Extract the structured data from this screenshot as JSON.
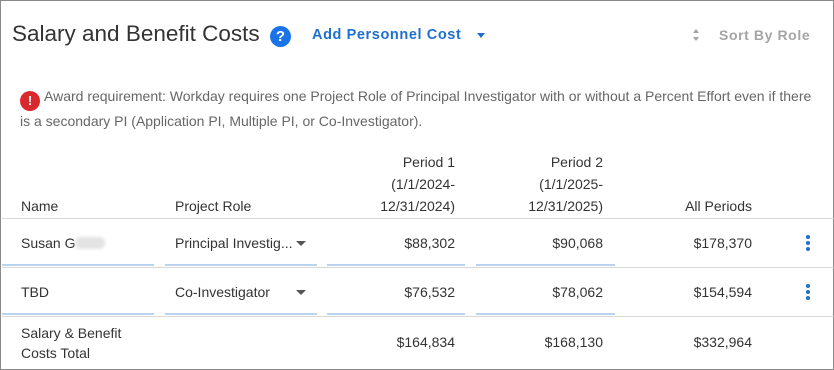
{
  "header": {
    "title": "Salary and Benefit Costs",
    "help_glyph": "?",
    "add_label": "Add Personnel Cost",
    "sort_label": "Sort By Role"
  },
  "alert": {
    "icon_glyph": "!",
    "text": "Award requirement: Workday requires one Project Role of Principal Investigator with or without a Percent Effort even if there is a secondary PI (Application PI, Multiple PI, or Co-Investigator)."
  },
  "table": {
    "headers": {
      "name": "Name",
      "role": "Project Role",
      "period1": [
        "Period 1",
        "(1/1/2024-",
        "12/31/2024)"
      ],
      "period2": [
        "Period 2",
        "(1/1/2025-",
        "12/31/2025)"
      ],
      "all": "All Periods"
    },
    "rows": [
      {
        "name": "Susan G",
        "name_redacted": true,
        "role": "Principal Investig...",
        "period1": "$88,302",
        "period2": "$90,068",
        "all": "$178,370"
      },
      {
        "name": "TBD",
        "name_redacted": false,
        "role": "Co-Investigator",
        "period1": "$76,532",
        "period2": "$78,062",
        "all": "$154,594"
      }
    ],
    "total": {
      "label_line1": "Salary & Benefit",
      "label_line2": "Costs Total",
      "period1": "$164,834",
      "period2": "$168,130",
      "all": "$332,964"
    }
  },
  "colors": {
    "accent": "#1f6fd1",
    "help_icon": "#1a73e8",
    "alert_icon": "#d9272e",
    "input_underline": "#b8d3ee",
    "muted": "#a5a5a5"
  },
  "icons": {
    "help": "question-circle-icon",
    "add_dropdown": "caret-down-icon",
    "sort": "sort-updown-icon",
    "alert": "exclamation-circle-icon",
    "row_menu": "kebab-menu-icon",
    "select_dropdown": "caret-down-icon"
  }
}
